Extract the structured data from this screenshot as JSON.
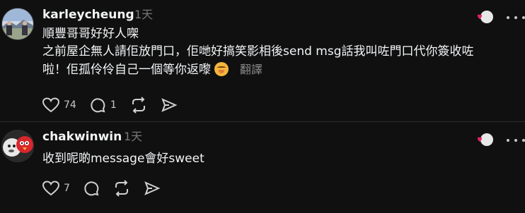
{
  "posts": [
    {
      "username": "karleycheung",
      "time": "1天",
      "lines": [
        "順豐哥哥好好人㗎",
        "之前屋企無人請佢放門口，佢哋好搞笑影相後send msg話我叫咗門口代你簽收咗",
        "啦！佢孤伶伶自己一個等你返嚟"
      ],
      "translate_label": "翻譯",
      "likes": "74",
      "replies": "1"
    },
    {
      "username": "chakwinwin",
      "time": "1天",
      "lines": [
        "收到呢啲message會好sweet"
      ],
      "likes": "7"
    }
  ],
  "colors": {
    "background": "#101010",
    "text": "#f3f5f7",
    "muted": "#777777",
    "heart": "#e0245e"
  }
}
